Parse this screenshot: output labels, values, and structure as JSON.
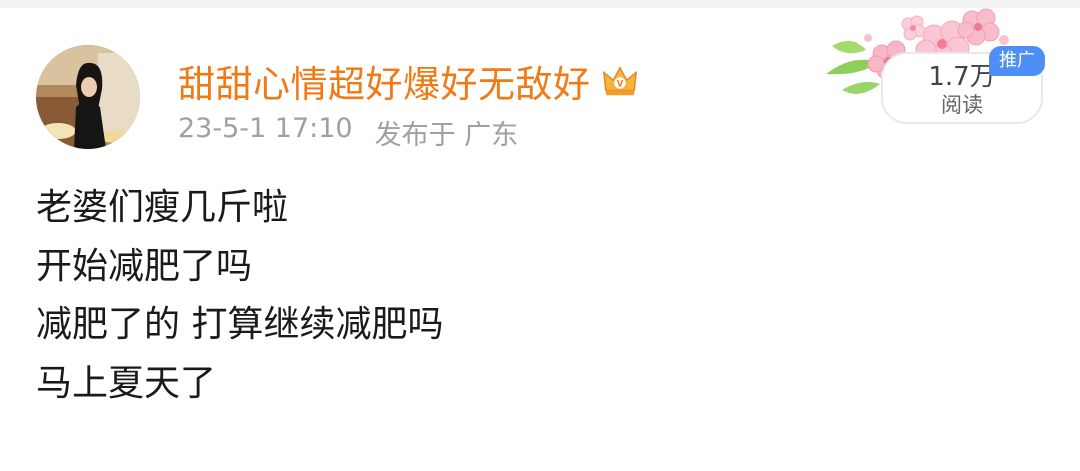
{
  "post": {
    "username": "甜甜心情超好爆好无敌好",
    "timestamp": "23-5-1 17:10",
    "location": "发布于 广东",
    "read_count": "1.7万",
    "read_label": "阅读",
    "promo_badge": "推广",
    "content_lines": [
      "老婆们瘦几斤啦",
      "开始减肥了吗",
      "减肥了的 打算继续减肥吗",
      "马上夏天了"
    ]
  },
  "icons": {
    "verified": "crown-icon",
    "decoration": "cherry-blossom-decoration"
  },
  "colors": {
    "username": "#f07a16",
    "meta": "#a0a0a0",
    "body_text": "#1a1a1a",
    "badge": "#4e8ef7"
  }
}
